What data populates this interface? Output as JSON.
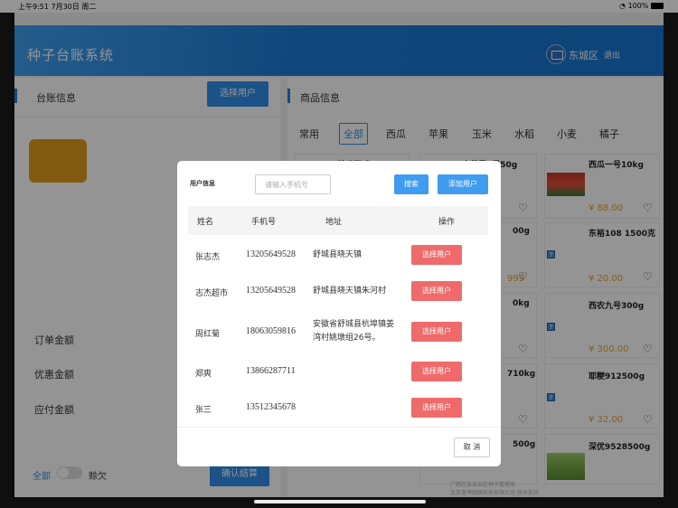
{
  "status_bar": {
    "time_date": "上午9:51  7月30日 周二",
    "battery": "100%"
  },
  "header": {
    "title": "种子台账系统",
    "region": "东城区",
    "logout": "退出"
  },
  "left_panel": {
    "title": "台账信息",
    "select_user_btn": "选择用户",
    "order_amount": "订单金额",
    "discount_amount": "优惠金额",
    "payable_amount": "应付金额",
    "all_label": "全部",
    "credit_label": "赊欠",
    "confirm_btn": "确认结算"
  },
  "right_panel": {
    "title": "商品信息",
    "tabs": [
      "常用",
      "全部",
      "西瓜",
      "苹果",
      "玉米",
      "水稻",
      "小麦",
      "橘子"
    ],
    "active_tab": "全部",
    "products": [
      {
        "name": "美味西瓜15kg"
      },
      {
        "name": "大苹果1号50g"
      },
      {
        "name": "西瓜一号10kg",
        "price": "¥ 88.00"
      },
      {
        "name": "00g"
      },
      {
        "name": "东裕108 1500克",
        "price": "¥ 20.00"
      },
      {
        "name": "0kg"
      },
      {
        "name": "西农九号300g",
        "price": "¥ 300.00"
      },
      {
        "name": "710kg"
      },
      {
        "name": "耶粳912500g",
        "price": "¥ 32.00"
      },
      {
        "name": "500g"
      },
      {
        "name": "深优9528500g"
      }
    ],
    "partial_price": "999",
    "footer_line1": "广西壮族自治区种子管理局",
    "footer_line2": "北京誉坤网络科技有限公司 技术支持"
  },
  "modal": {
    "label": "用户信息",
    "search_placeholder": "请输入手机号",
    "search_btn": "搜索",
    "add_user_btn": "添加用户",
    "columns": {
      "name": "姓名",
      "phone": "手机号",
      "address": "地址",
      "action": "操作"
    },
    "rows": [
      {
        "name": "张志杰",
        "phone": "13205649528",
        "address": "舒城县晓天镇",
        "action": "选择用户"
      },
      {
        "name": "志杰超市",
        "phone": "13205649528",
        "address": "舒城县晓天镇朱河村",
        "action": "选择用户"
      },
      {
        "name": "周红菊",
        "phone": "18063059816",
        "address": "安徽省舒城县杭埠镇姜湾村姚墩组26号。",
        "action": "选择用户"
      },
      {
        "name": "郑爽",
        "phone": "13866287711",
        "address": "",
        "action": "选择用户"
      },
      {
        "name": "张三",
        "phone": "13512345678",
        "address": "",
        "action": "选择用户"
      }
    ],
    "cancel_btn": "取 消"
  }
}
